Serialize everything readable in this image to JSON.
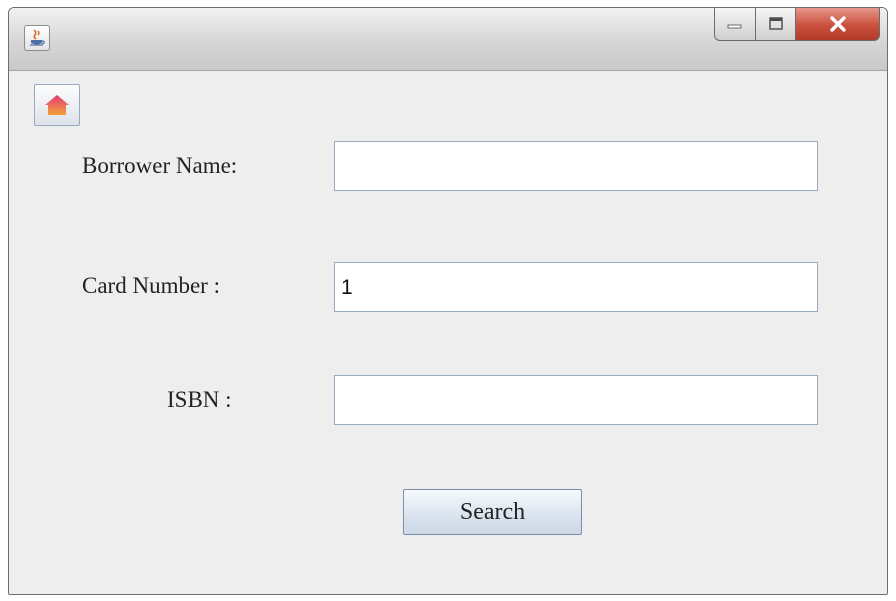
{
  "window": {
    "title": "",
    "controls": {
      "minimize": "minimize",
      "maximize": "maximize",
      "close": "close"
    }
  },
  "toolbar": {
    "home_icon": "home-icon"
  },
  "form": {
    "borrower_name": {
      "label": "Borrower Name:",
      "value": ""
    },
    "card_number": {
      "label": "Card Number :",
      "value": "1"
    },
    "isbn": {
      "label": "ISBN :",
      "value": ""
    },
    "search_label": "Search"
  },
  "colors": {
    "close_button": "#c9503d",
    "window_bg": "#eeeeee",
    "field_border": "#9aa9bd"
  }
}
